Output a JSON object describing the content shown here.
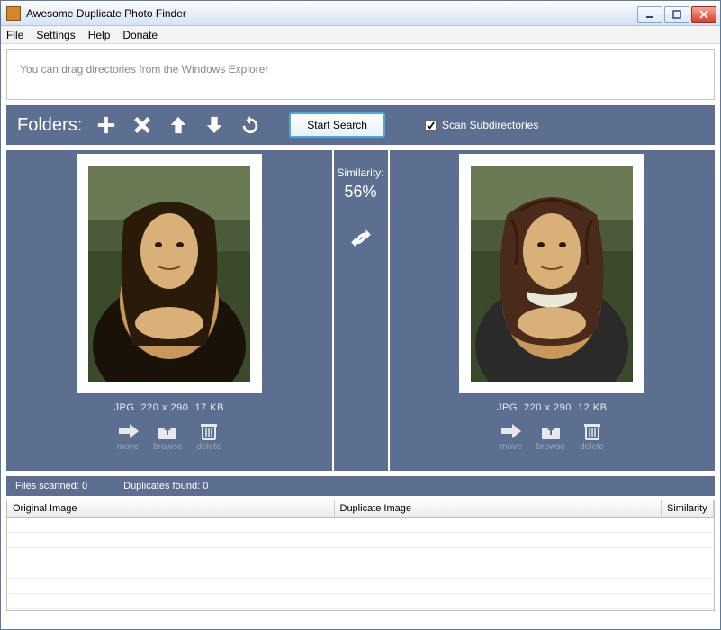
{
  "window": {
    "title": "Awesome Duplicate Photo Finder"
  },
  "menu": {
    "file": "File",
    "settings": "Settings",
    "help": "Help",
    "donate": "Donate"
  },
  "dropzone": {
    "hint": "You can drag directories from the Windows Explorer"
  },
  "toolbar": {
    "folders_label": "Folders:",
    "start_search": "Start Search",
    "scan_sub": "Scan Subdirectories",
    "scan_sub_checked": true
  },
  "similarity": {
    "label": "Similarity:",
    "value": "56%"
  },
  "left": {
    "format": "JPG",
    "dims": "220 x 290",
    "size": "17 KB",
    "move": "move",
    "browse": "browse",
    "delete": "delete"
  },
  "right": {
    "format": "JPG",
    "dims": "220 x 290",
    "size": "12 KB",
    "move": "move",
    "browse": "browse",
    "delete": "delete"
  },
  "status": {
    "files_scanned_label": "Files scanned:",
    "files_scanned_val": "0",
    "duplicates_label": "Duplicates found:",
    "duplicates_val": "0"
  },
  "columns": {
    "original": "Original Image",
    "duplicate": "Duplicate Image",
    "similarity": "Similarity"
  }
}
